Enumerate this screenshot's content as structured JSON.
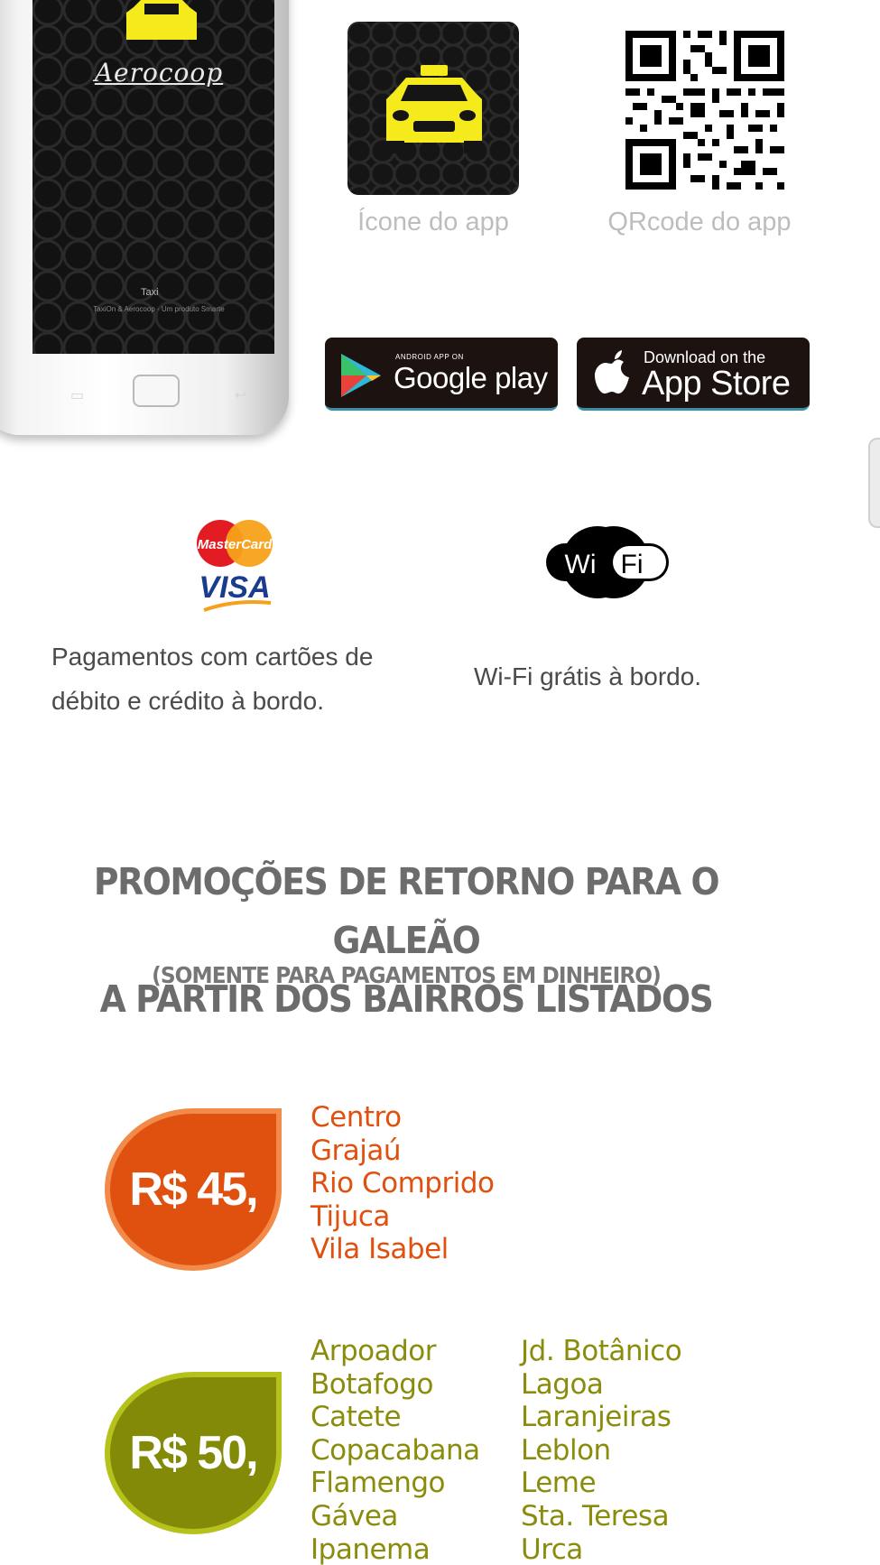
{
  "phone": {
    "logo_text": "Aerocoop",
    "badge_text": "Taxi",
    "small_text": "TaxiOn & Aerocoop · Um produto Smarte"
  },
  "app": {
    "icon_caption": "Ícone do app",
    "qr_caption": "QRcode do app"
  },
  "stores": {
    "google_small": "ANDROID APP ON",
    "google_big": "Google play",
    "apple_small": "Download on the",
    "apple_big": "App Store"
  },
  "features": {
    "cards_logo_top": "MasterCard",
    "cards_logo_bottom": "VISA",
    "cards_text": "Pagamentos com cartões de débito e crédito à bordo.",
    "wifi_logo_left": "Wi",
    "wifi_logo_right": "Fi",
    "wifi_text": "Wi-Fi grátis à bordo."
  },
  "promo": {
    "title_line1": "PROMOÇÕES DE RETORNO PARA O GALEÃO",
    "title_line2": "A PARTIR DOS BAIRROS LISTADOS",
    "subtitle": "(SOMENTE PARA PAGAMENTOS EM DINHEIRO)",
    "tiers": [
      {
        "price": "R$ 45,",
        "color": "#e0500f",
        "text_color": "#e0500f",
        "neighborhoods": [
          "Centro",
          "Grajaú",
          "Rio Comprido",
          "Tijuca",
          "Vila Isabel"
        ]
      },
      {
        "price": "R$ 50,",
        "color": "#828a07",
        "text_color": "#8a8c0c",
        "neighborhoods_col1": [
          "Arpoador",
          "Botafogo",
          "Catete",
          "Copacabana",
          "Flamengo",
          "Gávea",
          "Ipanema"
        ],
        "neighborhoods_col2": [
          "Jd. Botânico",
          "Lagoa",
          "Laranjeiras",
          "Leblon",
          "Leme",
          "Sta. Teresa",
          "Urca"
        ]
      }
    ]
  },
  "colors": {
    "taxi_yellow": "#f5ea1c",
    "caption_gray": "#bdbdbd",
    "store_badge_bg": "#1c1311"
  }
}
